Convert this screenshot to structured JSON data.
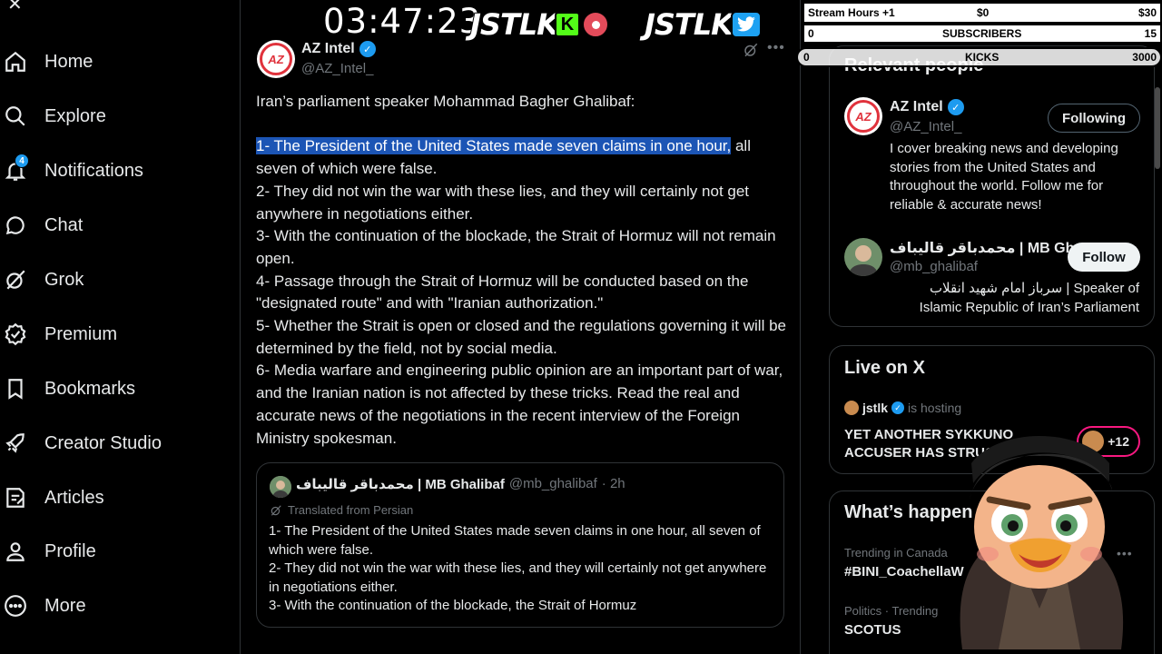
{
  "nav": {
    "items": [
      {
        "label": "Home",
        "icon": "home-icon"
      },
      {
        "label": "Explore",
        "icon": "search-icon"
      },
      {
        "label": "Notifications",
        "icon": "bell-icon",
        "badge": "4"
      },
      {
        "label": "Chat",
        "icon": "chat-icon"
      },
      {
        "label": "Grok",
        "icon": "grok-icon"
      },
      {
        "label": "Premium",
        "icon": "premium-icon"
      },
      {
        "label": "Bookmarks",
        "icon": "bookmark-icon"
      },
      {
        "label": "Creator Studio",
        "icon": "rocket-icon"
      },
      {
        "label": "Articles",
        "icon": "article-icon"
      },
      {
        "label": "Profile",
        "icon": "person-icon"
      },
      {
        "label": "More",
        "icon": "more-circle-icon"
      }
    ]
  },
  "tweet": {
    "author_name": "AZ Intel",
    "author_handle": "@AZ_Intel_",
    "avatar_text": "AZ",
    "intro": "Iran’s parliament speaker Mohammad Bagher Ghalibaf:",
    "line1_prefix": "1- ",
    "line1_highlight": "The President of the United States made seven claims in one hour,",
    "line1_rest": " all seven of which were false.",
    "line2": "2- They did not win the war with these lies, and they will certainly not get anywhere in negotiations either.",
    "line3": "3- With the continuation of the blockade, the Strait of Hormuz will not remain open.",
    "line4": "4- Passage through the Strait of Hormuz will be conducted based on the \"designated route\" and with \"Iranian authorization.\"",
    "line5": "5- Whether the Strait is open or closed and the regulations governing it will be determined by the field, not by social media.",
    "line6": "6- Media warfare and engineering public opinion are an important part of war, and the Iranian nation is not affected by these tricks. Read the real and accurate news of the negotiations in the recent interview of the Foreign Ministry spokesman."
  },
  "quote": {
    "name": "محمدباقر قالیباف | MB Ghalibaf",
    "handle": "@mb_ghalibaf",
    "time": "· 2h",
    "translated": "Translated from Persian",
    "line1": "1- The President of the United States made seven claims in one hour, all seven of which were false.",
    "line2": "2- They did not win the war with these lies, and they will certainly not get anywhere in negotiations either.",
    "line3": "3- With the continuation of the blockade, the Strait of Hormuz"
  },
  "relevant": {
    "title": "Relevant people",
    "p1": {
      "name": "AZ Intel",
      "handle": "@AZ_Intel_",
      "button": "Following",
      "bio": "I cover breaking news and developing stories from the United States and throughout the world. Follow me for reliable & accurate news!"
    },
    "p2": {
      "name": "محمدباقر قالیباف | MB Gh...",
      "handle": "@mb_ghalibaf",
      "button": "Follow",
      "bio_line1": "سرباز امام شهید انقلاب | Speaker of",
      "bio_line2": "Islamic Republic of Iran’s Parliament"
    }
  },
  "live": {
    "title": "Live on X",
    "host": "jstlk",
    "hosting": "is hosting",
    "headline_line1": "YET ANOTHER SYKKUNO",
    "headline_line2": "ACCUSER HAS STRUC",
    "count": "+12"
  },
  "happening": {
    "title": "What’s happen",
    "t1_context": "Trending in Canada",
    "t1_topic": "#BINI_CoachellaW",
    "t2_context": "Politics · Trending",
    "t2_topic": "SCOTUS"
  },
  "overlay": {
    "clock": "03:47:23",
    "logo1": "JSTLK",
    "logo1_badge": "K",
    "logo2": "JSTLK",
    "bar1_left": "Stream Hours +1",
    "bar1_mid": "$0",
    "bar1_right": "$30",
    "bar2_left": "0",
    "bar2_mid": "SUBSCRIBERS",
    "bar2_right": "15",
    "bar3_left": "0",
    "bar3_mid": "KICKS",
    "bar3_right": "3000"
  },
  "colors": {
    "accent": "#1d9bf0",
    "highlight": "#1c55b5",
    "kick_green": "#53fc18"
  }
}
